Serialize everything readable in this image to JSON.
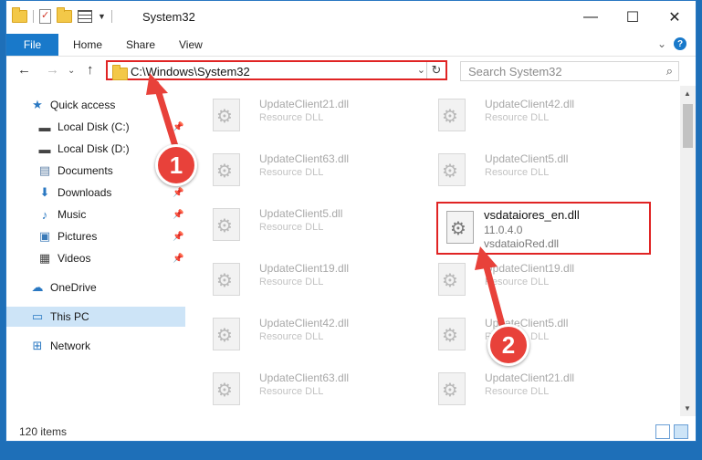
{
  "window": {
    "title": "System32"
  },
  "ribbon": {
    "tabs": [
      "File",
      "Home",
      "Share",
      "View"
    ]
  },
  "address": {
    "path": "C:\\Windows\\System32"
  },
  "search": {
    "placeholder": "Search System32"
  },
  "sidebar": {
    "items": [
      {
        "label": "Quick access",
        "icon": "star-icon",
        "pinned": false,
        "selected": false
      },
      {
        "label": "Local Disk (C:)",
        "icon": "drive-icon",
        "pinned": true,
        "selected": false
      },
      {
        "label": "Local Disk (D:)",
        "icon": "drive-icon",
        "pinned": false,
        "selected": false
      },
      {
        "label": "Documents",
        "icon": "documents-icon",
        "pinned": true,
        "selected": false
      },
      {
        "label": "Downloads",
        "icon": "download-icon",
        "pinned": true,
        "selected": false
      },
      {
        "label": "Music",
        "icon": "music-icon",
        "pinned": true,
        "selected": false
      },
      {
        "label": "Pictures",
        "icon": "pictures-icon",
        "pinned": true,
        "selected": false
      },
      {
        "label": "Videos",
        "icon": "videos-icon",
        "pinned": true,
        "selected": false
      },
      {
        "label": "OneDrive",
        "icon": "cloud-icon",
        "pinned": false,
        "selected": false
      },
      {
        "label": "This PC",
        "icon": "computer-icon",
        "pinned": false,
        "selected": true
      },
      {
        "label": "Network",
        "icon": "network-icon",
        "pinned": false,
        "selected": false
      }
    ]
  },
  "files": [
    {
      "name": "UpdateClient21.dll",
      "type": "Resource DLL"
    },
    {
      "name": "UpdateClient42.dll",
      "type": "Resource DLL"
    },
    {
      "name": "UpdateClient63.dll",
      "type": "Resource DLL"
    },
    {
      "name": "UpdateClient5.dll",
      "type": "Resource DLL"
    },
    {
      "name": "UpdateClient5.dll",
      "type": "Resource DLL"
    },
    {
      "name": "UpdateClient19.dll",
      "type": "Resource DLL"
    },
    {
      "name": "UpdateClient19.dll",
      "type": "Resource DLL"
    },
    {
      "name": "UpdateClient42.dll",
      "type": "Resource DLL"
    },
    {
      "name": "UpdateClient5.dll",
      "type": "Resource DLL"
    },
    {
      "name": "UpdateClient63.dll",
      "type": "Resource DLL"
    },
    {
      "name": "UpdateClient21.dll",
      "type": "Resource DLL"
    }
  ],
  "highlighted_file": {
    "name": "vsdataiores_en.dll",
    "version": "11.0.4.0",
    "description": "vsdataioRed.dll"
  },
  "status": {
    "item_count": "120 items"
  },
  "callouts": [
    "1",
    "2"
  ],
  "colors": {
    "accent": "#1979ca",
    "callout": "#e8413a",
    "highlight": "#e02424"
  }
}
